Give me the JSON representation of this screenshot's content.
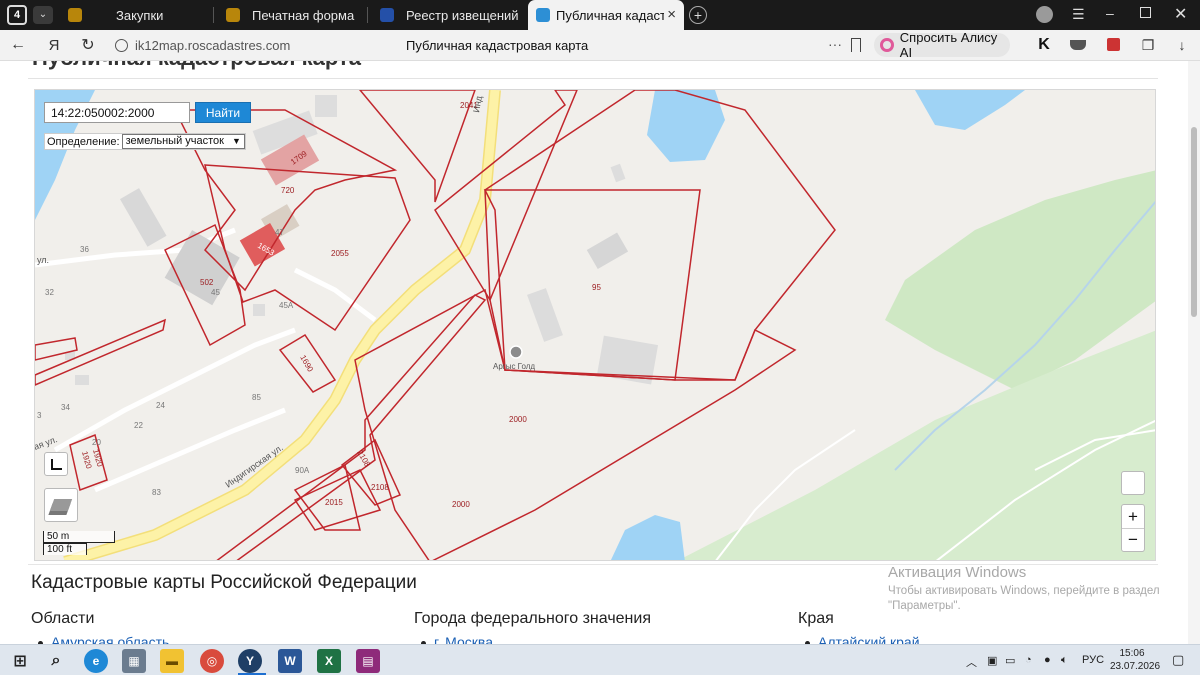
{
  "browser": {
    "tab_counter": "4",
    "tabs": [
      {
        "label": "Закупки",
        "active": false
      },
      {
        "label": "Печатная форма",
        "active": false
      },
      {
        "label": "Реестр извещений",
        "active": false
      },
      {
        "label": "Публичная кадастров",
        "active": true
      }
    ],
    "tab_close": "×",
    "new_tab": "+",
    "url": "ik12map.roscadastres.com",
    "page_title": "Публичная кадастровая карта",
    "alice_label": "Спросить Алису AI",
    "menu_dots": "···"
  },
  "page": {
    "cut_heading": "Публичная кадастровая карта"
  },
  "map": {
    "search_value": "14:22:050002:2000",
    "search_button": "Найти",
    "definition_label": "Определение:",
    "definition_value": "земельный участок",
    "zoom_in": "+",
    "zoom_out": "−",
    "scale_metric": "50 m",
    "scale_imperial": "100 ft",
    "place_label": "Аргыс Голд",
    "street_label": "Индигирская ул.",
    "street_label_top": "Инд",
    "street_label_left": "ул.",
    "street_label_left2": "ая ул.",
    "parcel_labels": [
      "2041",
      "1709",
      "720",
      "1653",
      "2055",
      "502",
      "95",
      "1690",
      "2000",
      "2000",
      "2108",
      "2108",
      "2015",
      "1920",
      "1920"
    ],
    "house_numbers": [
      "36",
      "32",
      "45",
      "45А",
      "47",
      "34",
      "24",
      "22",
      "85",
      "20",
      "90А",
      "83",
      "3"
    ]
  },
  "sections": {
    "heading": "Кадастровые карты Российской Федерации",
    "columns": [
      {
        "title": "Области",
        "first_item": "Амурская область"
      },
      {
        "title": "Города федерального значения",
        "first_item": "г. Москва"
      },
      {
        "title": "Края",
        "first_item": "Алтайский край"
      }
    ]
  },
  "watermark": {
    "title": "Активация Windows",
    "text": "Чтобы активировать Windows, перейдите в раздел \"Параметры\"."
  },
  "taskbar": {
    "apps": [
      "start",
      "search",
      "edge",
      "calculator",
      "explorer",
      "chrome",
      "yandex",
      "word",
      "excel",
      "winrar"
    ],
    "lang": "РУС",
    "time": "15:06",
    "date": "23.07.2026"
  },
  "colors": {
    "parcel": "#c1272d",
    "road": "#fdf2a7",
    "water": "#9fd3f5",
    "forest": "#d7ecce",
    "accent": "#1e88d6"
  }
}
